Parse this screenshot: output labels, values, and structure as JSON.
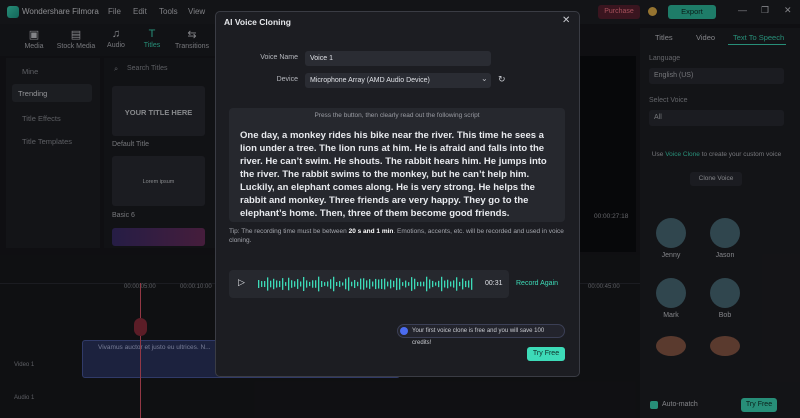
{
  "app": {
    "name": "Wondershare Filmora",
    "menu": [
      "File",
      "Edit",
      "Tools",
      "View"
    ],
    "purchase_label": "Purchase",
    "export_label": "Export"
  },
  "toolbar": {
    "items": [
      {
        "label": "Media",
        "icon": "media-icon"
      },
      {
        "label": "Stock Media",
        "icon": "stock-media-icon"
      },
      {
        "label": "Audio",
        "icon": "audio-icon"
      },
      {
        "label": "Titles",
        "icon": "titles-icon"
      },
      {
        "label": "Transitions",
        "icon": "transitions-icon"
      }
    ]
  },
  "left_panel": {
    "items": [
      "Mine",
      "Trending",
      "Title Effects",
      "Title Templates"
    ],
    "search_placeholder": "Search Titles",
    "cards": [
      {
        "preview_text": "YOUR TITLE HERE",
        "label": "Default Title"
      },
      {
        "preview_text": "Lorem ipsum",
        "label": "Basic 6"
      }
    ]
  },
  "right_panel": {
    "tabs": [
      "Titles",
      "Video",
      "Text To Speech"
    ],
    "language_label": "Language",
    "language_value": "English (US)",
    "voice_label": "Select Voice",
    "voice_value": "All",
    "clone_text_pre": "Use",
    "clone_link": "Voice Clone",
    "clone_text_post": "to create your custom voice",
    "clone_button": "Clone Voice",
    "voices": [
      "Jenny",
      "Jason",
      "Mark",
      "Bob"
    ],
    "auto_match_label": "Auto-match",
    "try_free_label": "Try Free"
  },
  "preview": {
    "time_display": "00:00:27:18"
  },
  "timeline": {
    "ruler_marks": [
      "00:00:05:00",
      "00:00:10:00",
      "00:00:45:00"
    ],
    "clip_text": "Vivamus auctor et justo eu ultrices. N...",
    "tracks": [
      "Video 1",
      "Audio 1"
    ]
  },
  "modal": {
    "title": "AI Voice Cloning",
    "voice_name_label": "Voice Name",
    "voice_name_value": "Voice 1",
    "device_label": "Device",
    "device_value": "Microphone Array (AMD Audio Device)",
    "script_hint": "Press the button, then clearly read out the following script",
    "script_text": "One day, a monkey rides his bike near the river. This time he sees a lion under a tree. The lion runs at him. He is afraid and falls into the river. He can’t swim. He shouts. The rabbit hears him. He jumps into the river. The rabbit swims to the monkey, but he can’t help him. Luckily, an elephant comes along. He is very strong. He helps the rabbit and monkey. Three friends are very happy. They go to the elephant’s home. Then, three of them become good friends.",
    "tip_pre": "Tip: The recording time must be between",
    "tip_bold": "20 s and 1 min",
    "tip_post": ". Emotions, accents, etc. will be recorded and used in voice cloning.",
    "recording_time": "00:31",
    "record_again_label": "Record Again",
    "free_note": "Your first voice clone is free and you will save 100 credits!",
    "try_free_label": "Try Free"
  },
  "colors": {
    "accent": "#3ddbb8",
    "modal_bg": "#1c1d22",
    "purchase": "#ff7c8c"
  }
}
